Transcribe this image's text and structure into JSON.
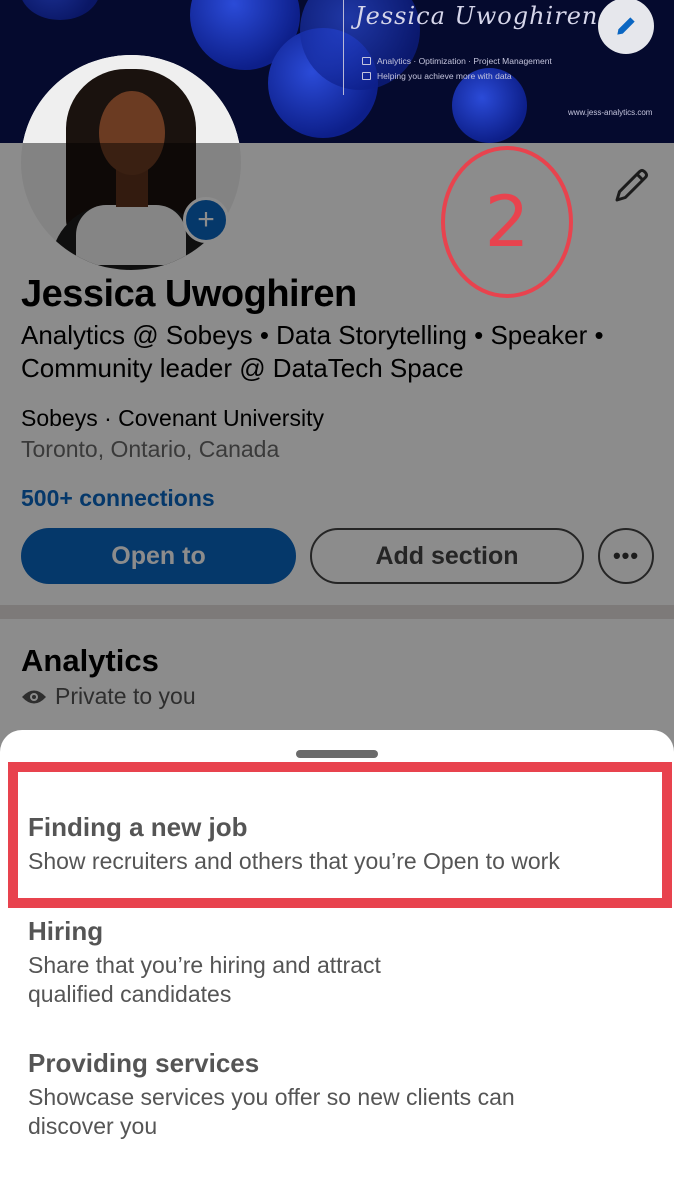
{
  "banner": {
    "name": "Jessica Uwoghiren",
    "tagline_1": "Analytics · Optimization · Project Management",
    "tagline_2": "Helping you achieve more with data",
    "url": "www.jess-analytics.com"
  },
  "profile": {
    "name": "Jessica Uwoghiren",
    "headline": "Analytics @ Sobeys • Data Storytelling • Speaker • Community leader @ DataTech Space",
    "orgs": "Sobeys · Covenant University",
    "location": "Toronto, Ontario, Canada",
    "connections": "500+ connections",
    "open_to_label": "Open to",
    "add_section_label": "Add section",
    "more_label": "•••",
    "add_photo_label": "+"
  },
  "analytics": {
    "title": "Analytics",
    "visibility": "Private to you"
  },
  "annotation": {
    "step_number": "2"
  },
  "sheet": {
    "options": [
      {
        "title": "Finding a new job",
        "description": "Show recruiters and others that you’re Open to work"
      },
      {
        "title": "Hiring",
        "description": "Share that you’re hiring and attract qualified candidates"
      },
      {
        "title": "Providing services",
        "description": "Showcase services you offer so new clients can discover you"
      }
    ]
  },
  "colors": {
    "accent": "#0a66c2",
    "annotation_red": "#e8434e",
    "banner_bg": "#050a2e"
  }
}
